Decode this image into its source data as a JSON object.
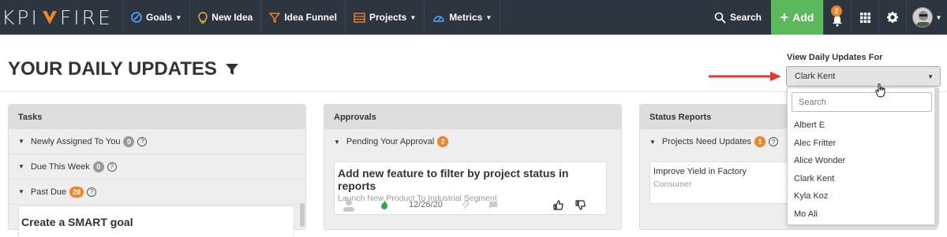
{
  "brand": {
    "logo_left": "KPI",
    "logo_right": "FIRE",
    "accent": "#f0842b"
  },
  "nav": {
    "goals": "Goals",
    "new_idea": "New Idea",
    "idea_funnel": "Idea Funnel",
    "projects": "Projects",
    "metrics": "Metrics",
    "search": "Search",
    "add": "Add",
    "notification_count": "2"
  },
  "page": {
    "title": "YOUR DAILY UPDATES",
    "view_for_label": "View Daily Updates For",
    "selected_user": "Clark Kent"
  },
  "dropdown": {
    "search_placeholder": "Search",
    "options": [
      "Albert E",
      "Alec Fritter",
      "Alice Wonder",
      "Clark Kent",
      "Kyla Koz",
      "Mo Ali"
    ]
  },
  "tasks": {
    "header": "Tasks",
    "sections": [
      {
        "label": "Newly Assigned To You",
        "count": "0"
      },
      {
        "label": "Due This Week",
        "count": "0"
      },
      {
        "label": "Past Due",
        "count": "28"
      }
    ],
    "card_title": "Create a SMART goal"
  },
  "approvals": {
    "header": "Approvals",
    "section_label": "Pending Your Approval",
    "section_count": "2",
    "card": {
      "title": "Add new feature to filter by project status in reports",
      "subtitle": "Launch New Product To Industrial Segment",
      "date": "12/26/20"
    }
  },
  "status_reports": {
    "header": "Status Reports",
    "section_label": "Projects Need Updates",
    "section_count": "1",
    "card": {
      "title": "Improve Yield in Factory",
      "subtitle": "Consumer"
    }
  },
  "colors": {
    "navbar": "#2d3540",
    "add_button": "#5cb85c",
    "badge": "#f0842b",
    "arrow": "#e03a2f"
  }
}
